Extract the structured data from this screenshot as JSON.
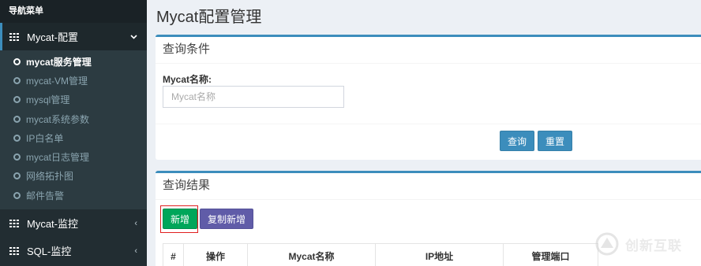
{
  "sidebar": {
    "header": "导航菜单",
    "groups": [
      {
        "label": "Mycat-配置",
        "chevron": "⌄",
        "expanded": true
      },
      {
        "label": "Mycat-监控",
        "chevron": "‹",
        "expanded": false
      },
      {
        "label": "SQL-监控",
        "chevron": "‹",
        "expanded": false
      }
    ],
    "items": [
      {
        "label": "mycat服务管理",
        "active": true
      },
      {
        "label": "mycat-VM管理"
      },
      {
        "label": "mysql管理"
      },
      {
        "label": "mycat系统参数"
      },
      {
        "label": "IP白名单"
      },
      {
        "label": "mycat日志管理"
      },
      {
        "label": "网络拓扑图"
      },
      {
        "label": "邮件告警"
      }
    ]
  },
  "main": {
    "title": "Mycat配置管理",
    "query": {
      "header": "查询条件",
      "field_label": "Mycat名称:",
      "field_placeholder": "Mycat名称",
      "field_value": "",
      "search_button": "查询",
      "reset_button": "重置"
    },
    "results": {
      "header": "查询结果",
      "new_button": "新增",
      "copy_button": "复制新增",
      "columns": [
        "#",
        "操作",
        "Mycat名称",
        "IP地址",
        "管理端口"
      ]
    }
  },
  "watermark": {
    "text": "创新互联"
  },
  "colors": {
    "sidebar": "#222d32",
    "accent": "#3c8dbc",
    "success": "#00a65a",
    "purple": "#605ca8"
  }
}
